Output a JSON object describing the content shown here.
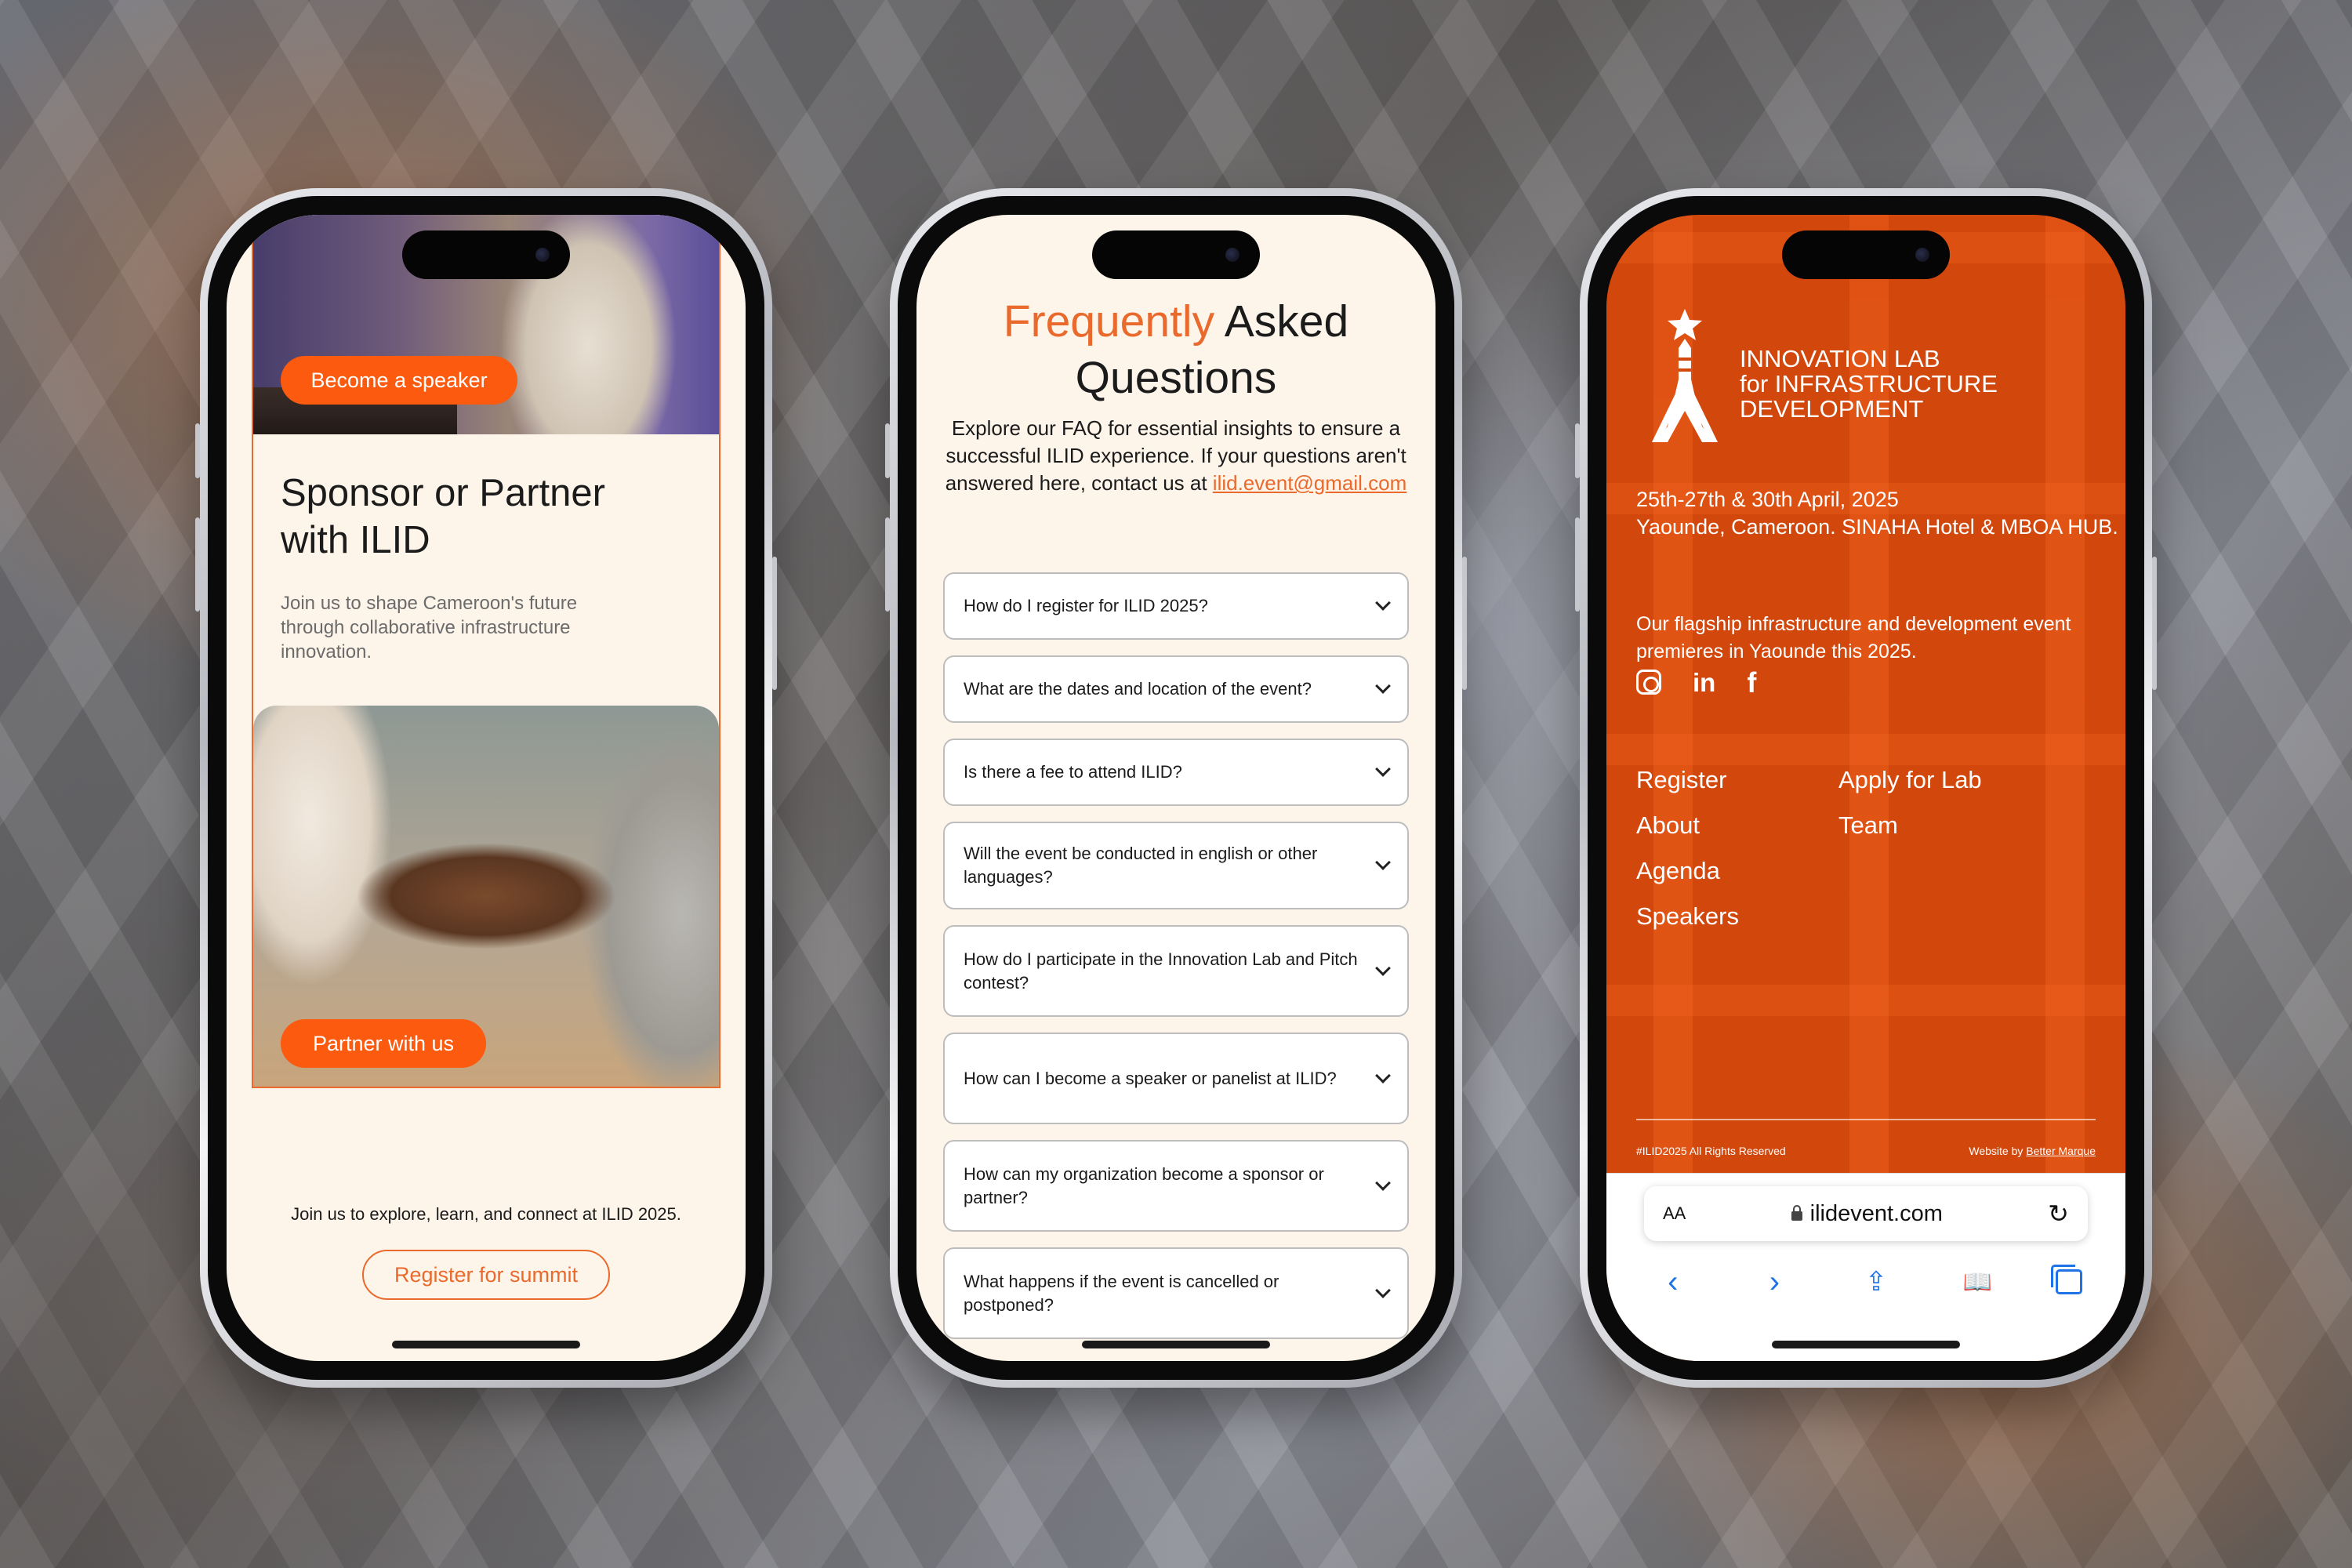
{
  "phone1": {
    "hero_button": "Become a speaker",
    "heading": "Sponsor or Partner with ILID",
    "subtext": "Join us to shape Cameroon's future through collaborative infrastructure innovation.",
    "partner_button": "Partner with us",
    "join_text": "Join us to explore, learn, and connect at ILID 2025.",
    "register_button": "Register for summit"
  },
  "phone2": {
    "title_accent": "Frequently",
    "title_rest": " Asked Questions",
    "intro": "Explore our FAQ for essential insights to ensure a successful ILID experience. If your questions aren't answered here, contact us at ",
    "email": "ilid.event@gmail.com",
    "faqs": [
      "How do I register for ILID 2025?",
      "What are the dates and location of the event?",
      "Is there a fee to attend ILID?",
      "Will the event be conducted in english or other languages?",
      "How do I participate in the Innovation Lab and Pitch contest?",
      "How can I become a speaker or panelist at ILID?",
      "How can my organization become a sponsor or partner?",
      "What happens if the event is cancelled or postponed?"
    ]
  },
  "phone3": {
    "org_line1": "INNOVATION LAB",
    "org_line2": "for INFRASTRUCTURE",
    "org_line3": "DEVELOPMENT",
    "dates_line1": "25th-27th & 30th April, 2025",
    "dates_line2": "Yaounde, Cameroon. SINAHA Hotel & MBOA HUB.",
    "tagline": "Our flagship infrastructure and development event premieres  in Yaounde this 2025.",
    "nav_links": [
      "Register",
      "Apply for Lab",
      "About",
      "Team",
      "Agenda",
      "",
      "Speakers",
      ""
    ],
    "copyright": "#ILID2025 All Rights Reserved",
    "credit_prefix": "Website by ",
    "credit_link": "Better Marque",
    "browser": {
      "text_size": "AA",
      "domain": "ilidevent.com"
    },
    "icons": {
      "social": [
        "instagram-icon",
        "linkedin-icon",
        "facebook-icon"
      ],
      "toolbar": [
        "back-icon",
        "forward-icon",
        "share-icon",
        "bookmarks-icon",
        "tabs-icon"
      ]
    },
    "accent_color": "#d2470c"
  },
  "colors": {
    "brand_orange": "#fb5a0f",
    "accent_text": "#e96a2c",
    "cream": "#fdf4ea",
    "safari_blue": "#1f73e6"
  }
}
